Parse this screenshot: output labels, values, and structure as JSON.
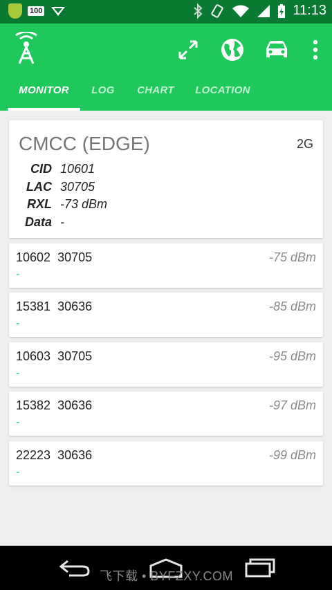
{
  "status_bar": {
    "notification_badge": "100",
    "time": "11:13",
    "icons": [
      "shield-icon",
      "download-arrow-icon",
      "bluetooth-icon",
      "rotate-icon",
      "wifi-icon",
      "signal-icon",
      "battery-icon"
    ]
  },
  "colors": {
    "accent": "#1ec85a",
    "status_bar": "#0a7a33",
    "background": "#eeeeee"
  },
  "app_bar": {
    "icons": [
      "antenna-icon",
      "expand-icon",
      "globe-icon",
      "car-icon",
      "overflow-menu-icon"
    ],
    "tabs": [
      {
        "label": "MONITOR",
        "selected": true
      },
      {
        "label": "LOG",
        "selected": false
      },
      {
        "label": "CHART",
        "selected": false
      },
      {
        "label": "LOCATION",
        "selected": false
      }
    ]
  },
  "serving_cell": {
    "operator": "CMCC (EDGE)",
    "generation": "2G",
    "fields": [
      {
        "key": "CID",
        "value": "10601"
      },
      {
        "key": "LAC",
        "value": "30705"
      },
      {
        "key": "RXL",
        "value": "-73 dBm"
      },
      {
        "key": "Data",
        "value": "-"
      }
    ]
  },
  "neighbours": [
    {
      "cid": "10602",
      "lac": "30705",
      "signal": "-75 dBm",
      "extra": "-"
    },
    {
      "cid": "15381",
      "lac": "30636",
      "signal": "-85 dBm",
      "extra": "-"
    },
    {
      "cid": "10603",
      "lac": "30705",
      "signal": "-95 dBm",
      "extra": "-"
    },
    {
      "cid": "15382",
      "lac": "30636",
      "signal": "-97 dBm",
      "extra": "-"
    },
    {
      "cid": "22223",
      "lac": "30636",
      "signal": "-99 dBm",
      "extra": "-"
    }
  ],
  "nav_bar": {
    "icons": [
      "back-icon",
      "home-icon",
      "recents-icon"
    ],
    "watermark": "飞下载 • BYFZXY.COM"
  }
}
